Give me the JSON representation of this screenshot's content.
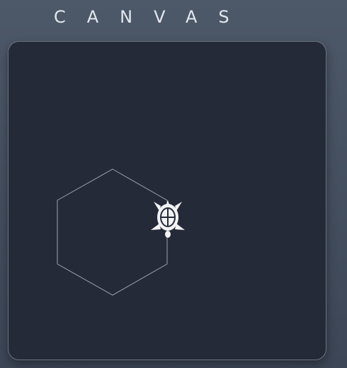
{
  "header": {
    "title": "CANVAS"
  },
  "canvas": {
    "shape": "hexagon",
    "cursor": "turtle-icon",
    "colors": {
      "background": "#242a37",
      "stroke": "#9ea3ae",
      "turtle": "#f2f3f5",
      "border": "#6b7382"
    }
  }
}
